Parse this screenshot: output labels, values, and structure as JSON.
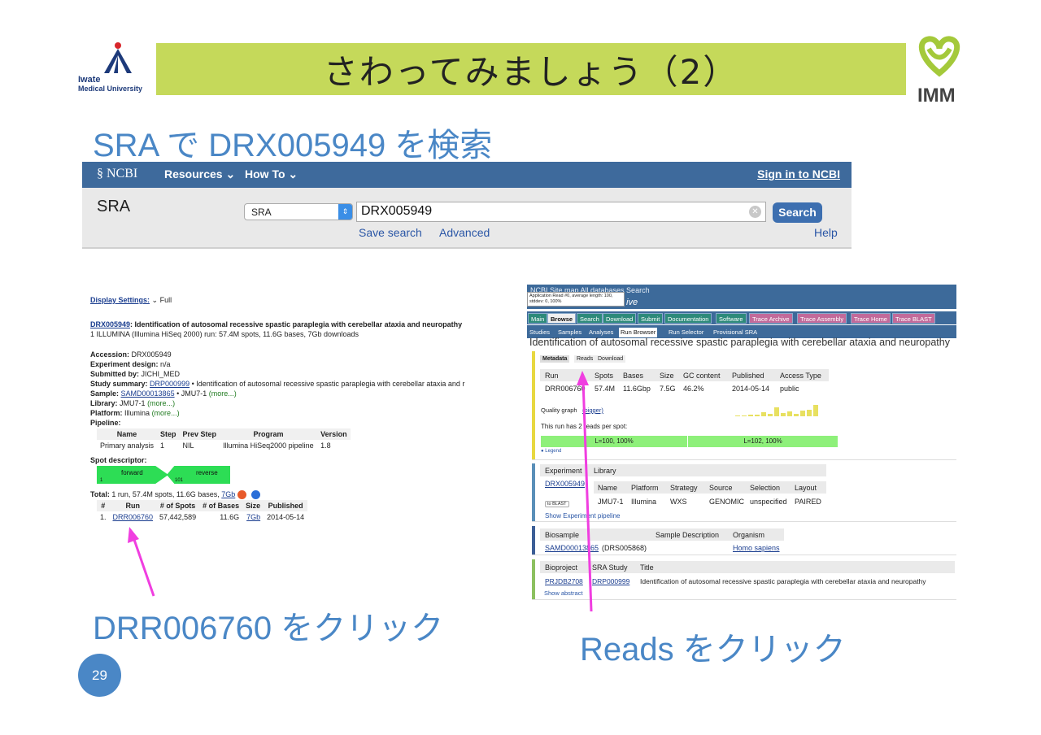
{
  "header": {
    "logo_left_line1": "Iwate",
    "logo_left_line2": "Medical University",
    "title": "さわってみましょう（2）",
    "logo_right_text": "IMM"
  },
  "subtitle": "SRA で DRX005949 を検索",
  "ncbi": {
    "brand": "NCBI",
    "resources": "Resources",
    "howto": "How To",
    "signin": "Sign in to NCBI",
    "db_label": "SRA",
    "db_select": "SRA",
    "query": "DRX005949",
    "search_button": "Search",
    "save_search": "Save search",
    "advanced": "Advanced",
    "help": "Help"
  },
  "left_panel": {
    "display_settings": "Display Settings:",
    "display_mode": "Full",
    "accession_link": "DRX005949",
    "title": ": Identification of autosomal recessive spastic paraplegia with cerebellar ataxia and neuropathy",
    "summary": "1 ILLUMINA (Illumina HiSeq 2000) run: 57.4M spots, 11.6G bases, 7Gb downloads",
    "accession_label": "Accession:",
    "accession": "DRX005949",
    "design_label": "Experiment design:",
    "design": "n/a",
    "submitted_label": "Submitted by:",
    "submitted": "JICHI_MED",
    "study_label": "Study summary:",
    "study_link": "DRP000999",
    "study_text": "• Identification of autosomal recessive spastic paraplegia with cerebellar ataxia and r",
    "sample_label": "Sample:",
    "sample_link": "SAMD00013865",
    "sample_text": "• JMU7-1",
    "library_label": "Library:",
    "library": "JMU7-1",
    "platform_label": "Platform:",
    "platform": "Illumina",
    "more": "(more...)",
    "pipeline_label": "Pipeline:",
    "pipeline_headers": [
      "Name",
      "Step",
      "Prev Step",
      "Program",
      "Version"
    ],
    "pipeline_row": [
      "Primary analysis",
      "1",
      "NIL",
      "Illumina HiSeq2000 pipeline",
      "1.8"
    ],
    "spot_label": "Spot descriptor:",
    "spot_fwd_num": "1",
    "spot_fwd": "forward",
    "spot_rev_num": "101",
    "spot_rev": "reverse",
    "total_label": "Total:",
    "total_text": "1 run, 57.4M spots, 11.6G bases,",
    "total_link": "7Gb",
    "runs_headers": [
      "#",
      "Run",
      "# of Spots",
      "# of Bases",
      "Size",
      "Published"
    ],
    "runs_row": [
      "1.",
      "DRR006760",
      "57,442,589",
      "11.6G",
      "7Gb",
      "2014-05-14"
    ]
  },
  "right_panel": {
    "top_links": "NCBI   Site map   All databases   Search",
    "tooltip": "Application Read #0, average length: 100, stddev: 0, 100%",
    "archive": "ive",
    "nav_tabs": [
      "Main",
      "Browse",
      "Search",
      "Download",
      "Submit",
      "Documentation",
      "Software",
      "Trace Archive",
      "Trace Assembly",
      "Trace Home",
      "Trace BLAST"
    ],
    "sub_tabs": [
      "Studies",
      "Samples",
      "Analyses",
      "Run Browser",
      "Run Selector",
      "Provisional SRA"
    ],
    "run_title": "Identification of autosomal recessive spastic paraplegia with cerebellar ataxia and neuropathy",
    "view_tabs": [
      "Metadata",
      "Reads",
      "Download"
    ],
    "run_headers": [
      "Run",
      "Spots",
      "Bases",
      "Size",
      "GC content",
      "Published",
      "Access Type"
    ],
    "run_values": [
      "DRR006760",
      "57.4M",
      "11.6Gbp",
      "7.5G",
      "46.2%",
      "2014-05-14",
      "public"
    ],
    "quality_graph": "Quality graph",
    "bigger": "(bigger)",
    "reads_per_spot": "This run has 2 reads per spot:",
    "read1": "L=100, 100%",
    "read2": "L=102, 100%",
    "legend": "Legend",
    "exp_headers": [
      "Experiment",
      "Library"
    ],
    "exp_link": "DRX005949",
    "to_blast": "to BLAST",
    "lib_headers": [
      "Name",
      "Platform",
      "Strategy",
      "Source",
      "Selection",
      "Layout"
    ],
    "lib_values": [
      "JMU7-1",
      "Illumina",
      "WXS",
      "GENOMIC",
      "unspecified",
      "PAIRED"
    ],
    "show_pipeline": "Show Experiment pipeline",
    "bio_headers": [
      "Biosample",
      "Sample Description",
      "Organism"
    ],
    "bio_link": "SAMD00013865",
    "bio_extra": "(DRS005868)",
    "organism": "Homo sapiens",
    "proj_headers": [
      "Bioproject",
      "SRA Study",
      "Title"
    ],
    "proj_link": "PRJDB2708",
    "study_link": "DRP000999",
    "proj_title": "Identification of autosomal recessive spastic paraplegia with cerebellar ataxia and neuropathy",
    "show_abstract": "Show abstract"
  },
  "annotations": {
    "left_caption": "DRR006760 をクリック",
    "right_caption": "Reads をクリック",
    "arrow_color": "#f03ee0"
  },
  "page_number": "29"
}
